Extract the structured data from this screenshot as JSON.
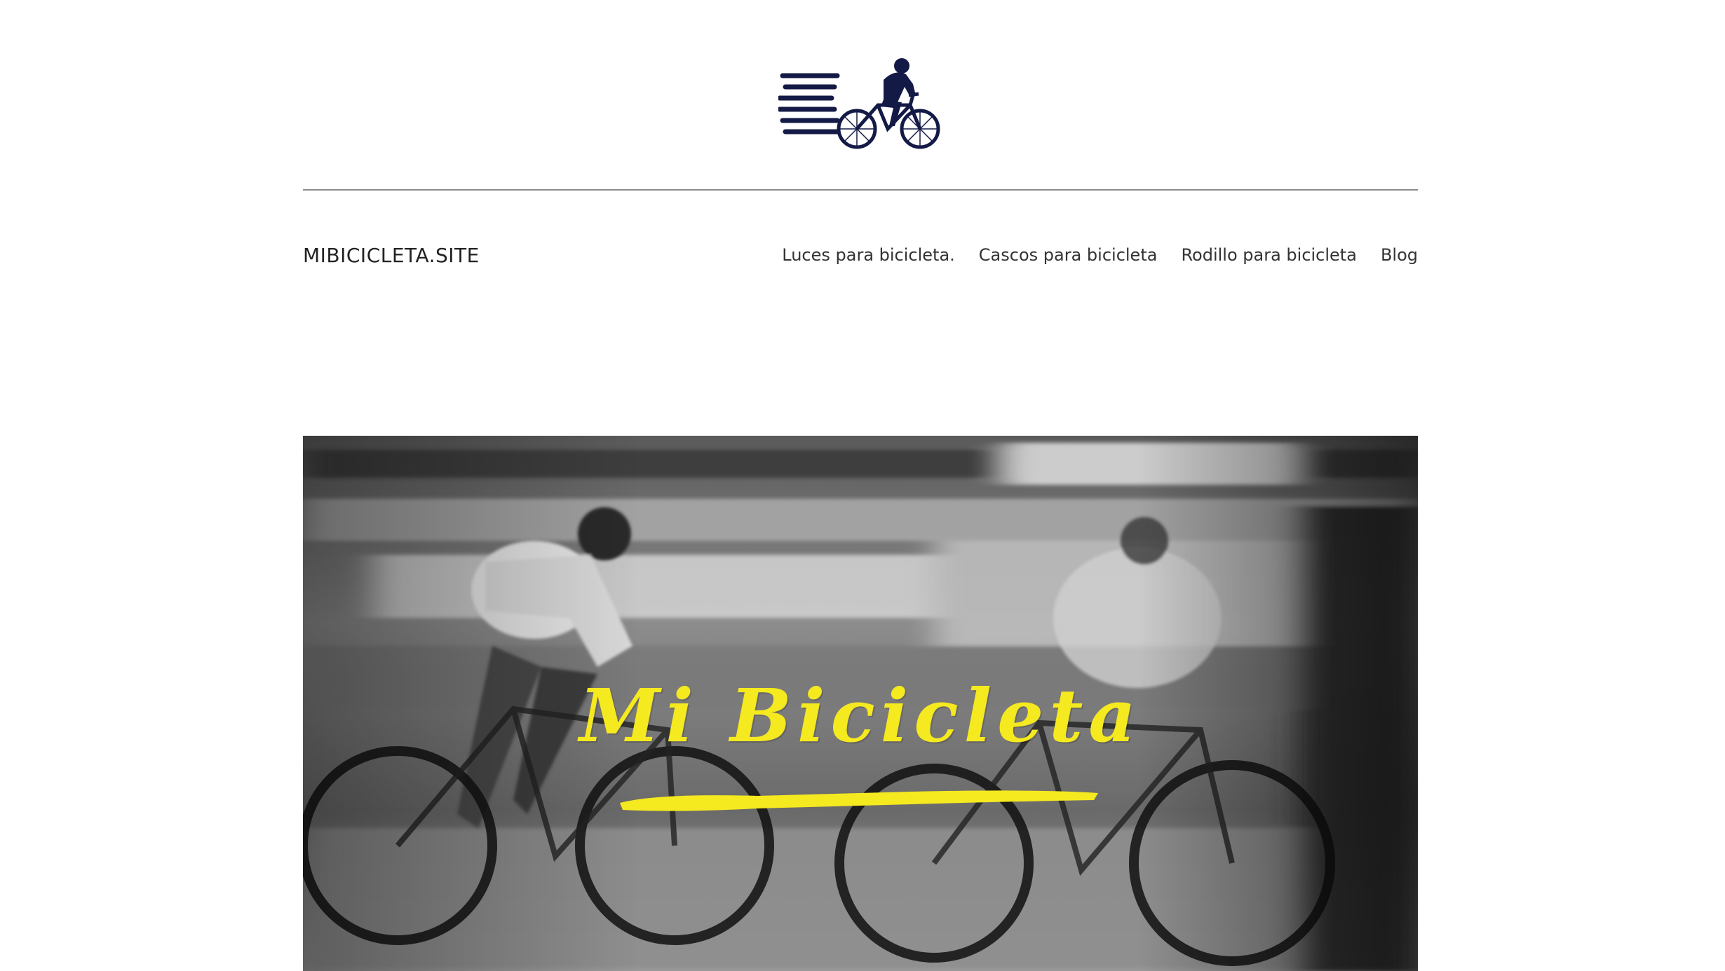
{
  "header": {
    "logo_icon": "cyclist-speed-logo-icon",
    "site_title": "MIBICICLETA.SITE"
  },
  "nav": {
    "items": [
      {
        "label": "Luces para bicicleta."
      },
      {
        "label": "Cascos para bicicleta"
      },
      {
        "label": "Rodillo para bicicleta"
      },
      {
        "label": "Blog"
      }
    ]
  },
  "hero": {
    "title": "Mi Bicicleta",
    "image": "blurred-cyclists-racing-photo"
  },
  "colors": {
    "logo": "#141a46",
    "accent": "#f5e91f",
    "divider": "#8a8a8a",
    "text": "#333333"
  }
}
